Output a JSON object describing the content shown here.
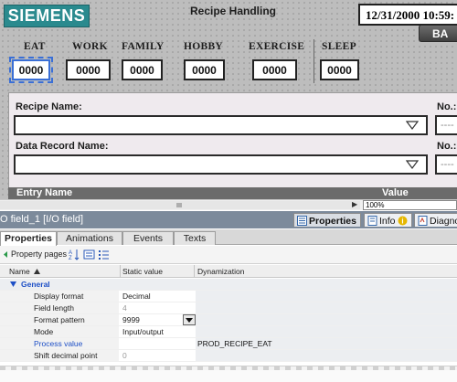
{
  "hmi": {
    "logo_text": "SIEMENS",
    "screen_title": "Recipe Handling",
    "datetime": "12/31/2000 10:59:",
    "button_label": "BA",
    "categories": [
      {
        "label": "EAT",
        "value": "0000"
      },
      {
        "label": "WORK",
        "value": "0000"
      },
      {
        "label": "FAMILY",
        "value": "0000"
      },
      {
        "label": "HOBBY",
        "value": "0000"
      },
      {
        "label": "EXERCISE",
        "value": "0000"
      },
      {
        "label": "SLEEP",
        "value": "0000"
      }
    ],
    "recipe_name_label": "Recipe Name:",
    "data_record_label": "Data Record Name:",
    "no_label": "No.:",
    "no_placeholder": "----",
    "entry_name_header": "Entry Name",
    "value_header": "Value",
    "zoom_value": "100%"
  },
  "inspector": {
    "title": "O field_1 [I/O field]",
    "tabs": [
      {
        "label": "Properties",
        "active": true
      },
      {
        "label": "Info",
        "active": false
      },
      {
        "label": "Diagnos",
        "active": false
      }
    ],
    "subtabs": [
      "Properties",
      "Animations",
      "Events",
      "Texts"
    ],
    "toolbar_label": "Property pages",
    "columns": [
      "Name",
      "Static value",
      "Dynamization"
    ],
    "group": "General",
    "rows": [
      {
        "name": "Display format",
        "value": "Decimal",
        "dyn": ""
      },
      {
        "name": "Field length",
        "value": "4",
        "dyn": ""
      },
      {
        "name": "Format pattern",
        "value": "9999",
        "dyn": ""
      },
      {
        "name": "Mode",
        "value": "Input/output",
        "dyn": ""
      },
      {
        "name": "Process value",
        "value": "",
        "dyn": "PROD_RECIPE_EAT"
      },
      {
        "name": "Shift decimal point",
        "value": "0",
        "dyn": ""
      }
    ]
  },
  "colors": {
    "siemens_teal": "#2a8a8e",
    "selection_blue": "#3a6fd6",
    "link_blue": "#1d4fc6",
    "inspector_bar": "#7c8a9b"
  }
}
